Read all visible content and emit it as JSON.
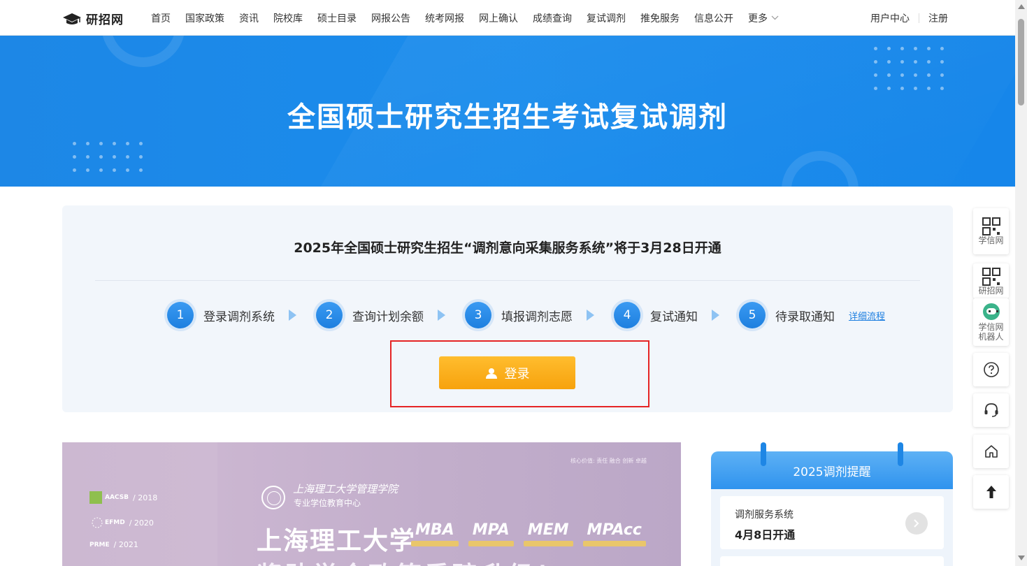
{
  "nav": {
    "logo_text": "研招网",
    "items": [
      "首页",
      "国家政策",
      "资讯",
      "院校库",
      "硕士目录",
      "网报公告",
      "统考网报",
      "网上确认",
      "成绩查询",
      "复试调剂",
      "推免服务",
      "信息公开"
    ],
    "more_label": "更多",
    "user_center": "用户中心",
    "register": "注册"
  },
  "banner": {
    "title": "全国硕士研究生招生考试复试调剂"
  },
  "notice": {
    "title": "2025年全国硕士研究生招生“调剂意向采集服务系统”将于3月28日开通",
    "steps": [
      {
        "num": "1",
        "label": "登录调剂系统"
      },
      {
        "num": "2",
        "label": "查询计划余额"
      },
      {
        "num": "3",
        "label": "填报调剂志愿"
      },
      {
        "num": "4",
        "label": "复试通知"
      },
      {
        "num": "5",
        "label": "待录取通知"
      }
    ],
    "detail_link": "详细流程",
    "login_label": "登录"
  },
  "ad": {
    "accreditations": [
      {
        "badge": "AACSB",
        "year": "/ 2018"
      },
      {
        "badge": "EFMD",
        "year": "/ 2020"
      },
      {
        "badge": "PRME",
        "year": "/ 2021"
      }
    ],
    "school_name": "上海理工大学管理学院",
    "center": "专业学位教育中心",
    "motto": "核心价值: 责任 融合 创新 卓越",
    "headline": "上海理工大学",
    "programs": [
      "MBA",
      "MPA",
      "MEM",
      "MPAcc"
    ],
    "subline": "奖助学金政策重磅升级！"
  },
  "reminder": {
    "title": "2025调剂提醒",
    "item_title": "调剂服务系统",
    "item_date": "4月8日开通"
  },
  "side_tools": {
    "xuexin": "学信网",
    "yanzhao": "研招网",
    "robot_line1": "学信网",
    "robot_line2": "机器人"
  },
  "colors": {
    "brand_blue": "#1a8cec",
    "login_orange": "#f7a20d",
    "highlight_red": "#e52424"
  }
}
